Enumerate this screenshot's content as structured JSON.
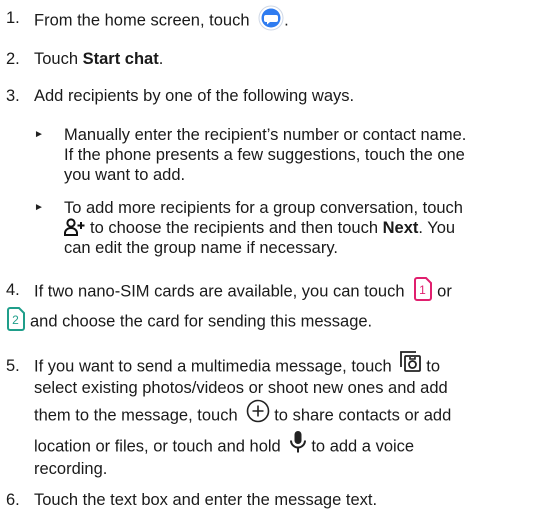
{
  "steps": [
    {
      "num": "1.",
      "text_a": "From the home screen, touch",
      "text_b": "."
    },
    {
      "num": "2.",
      "text_a": "Touch ",
      "bold": "Start chat",
      "text_b": "."
    },
    {
      "num": "3.",
      "text": "Add recipients by one of the following ways."
    },
    {
      "num": "4.",
      "line1_a": "If two nano-SIM cards are available, you can touch",
      "line1_b": "or",
      "line2_b": "and choose the card for sending this message."
    },
    {
      "num": "5.",
      "line1_a": "If you want to send a multimedia message, touch",
      "line2": "select existing photos/videos or shoot new ones and add",
      "line3_a": "them to the message, touch",
      "line3_b": "to share contacts or add",
      "line4_a": "location or files, or touch and hold",
      "line4_b": "to add a voice",
      "line5": "recording."
    },
    {
      "num": "6.",
      "text": "Touch the text box and enter the message text."
    }
  ],
  "bullets": [
    {
      "marker": "►",
      "line1": "Manually enter the recipient’s number or contact name.",
      "line2": "If the phone presents a few suggestions, touch the one",
      "line3": "you want to add."
    },
    {
      "marker": "►",
      "line1": "To add more recipients for a group conversation, touch",
      "line2_b": "to choose the recipients and then touch ",
      "line2_bold": "Next",
      "line2_c": ". You",
      "line3": "can edit the group name if necessary."
    }
  ],
  "step5_line1_tail": "to",
  "sim1_glyph": "1",
  "sim2_glyph": "2",
  "colors": {
    "messages_blue": "#2f7cf0",
    "sim_pink": "#e01f6e",
    "sim_teal": "#1f9e8a",
    "text": "#1a1a1a"
  },
  "icons": [
    "messages-app-icon",
    "add-contact-icon",
    "sim1-icon",
    "sim2-icon",
    "gallery-icon",
    "add-circle-icon",
    "mic-icon"
  ]
}
